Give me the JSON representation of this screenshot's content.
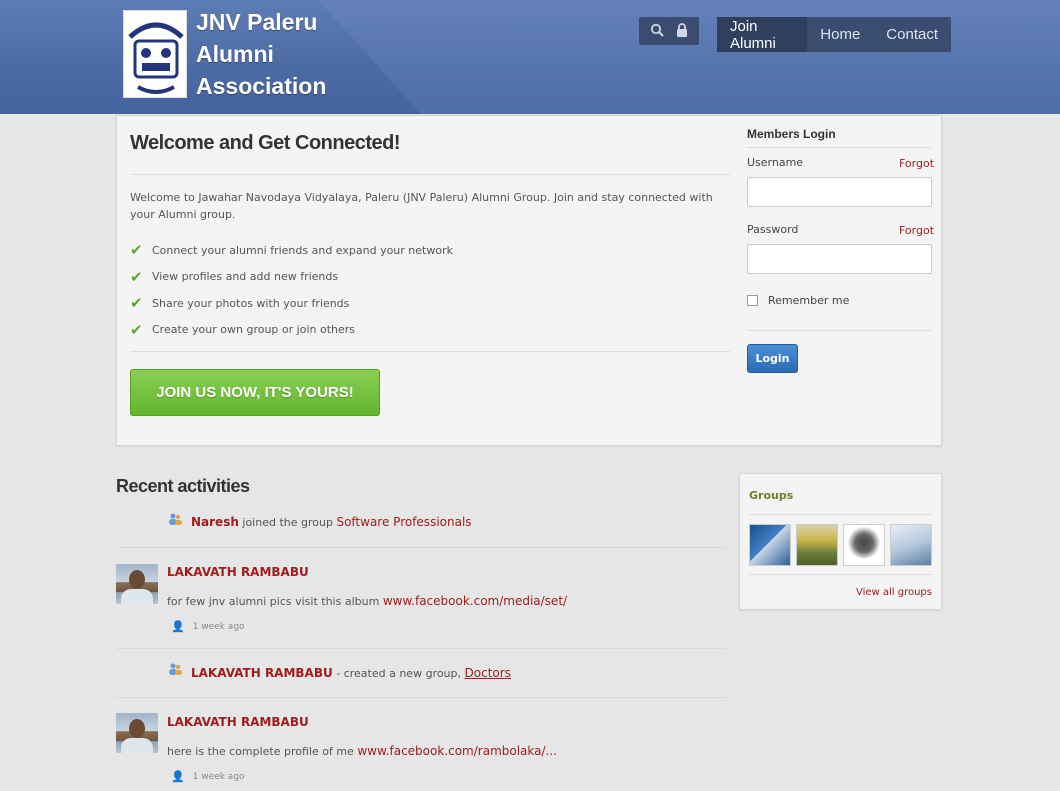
{
  "header": {
    "site_title": "JNV Paleru Alumni Association",
    "logo_icon": "school-emblem-icon",
    "tools": {
      "search_icon": "search-icon",
      "lock_icon": "lock-icon"
    },
    "nav": [
      {
        "label": "Join Alumni",
        "active": true
      },
      {
        "label": "Home",
        "active": false
      },
      {
        "label": "Contact",
        "active": false
      }
    ]
  },
  "welcome": {
    "title": "Welcome and Get Connected!",
    "intro": "Welcome to Jawahar Navodaya Vidyalaya, Paleru (JNV Paleru) Alumni Group. Join and stay connected with your Alumni group.",
    "features": [
      "Connect your alumni friends and expand your network",
      "View profiles and add new friends",
      "Share your photos with your friends",
      "Create your own group or join others"
    ],
    "join_button": "JOIN US NOW, IT'S YOURS!"
  },
  "login": {
    "title": "Members Login",
    "username_label": "Username",
    "username_value": "",
    "password_label": "Password",
    "password_value": "",
    "forgot_label": "Forgot",
    "remember_label": "Remember me",
    "remember_checked": false,
    "login_button": "Login"
  },
  "activities": {
    "title": "Recent activities",
    "items": [
      {
        "type": "group-join",
        "name": "Naresh",
        "text": "joined the group",
        "link": "Software Professionals"
      },
      {
        "type": "post",
        "name": "LAKAVATH RAMBABU",
        "text": "for few jnv alumni pics visit this album",
        "link": "www.facebook.com/media/set/",
        "time": "1 week ago"
      },
      {
        "type": "group-create",
        "name": "LAKAVATH RAMBABU",
        "text": "- created a new group,",
        "link": "Doctors"
      },
      {
        "type": "post",
        "name": "LAKAVATH RAMBABU",
        "text": "here is the complete profile of me",
        "link": "www.facebook.com/rambolaka/...",
        "time": "1 week ago"
      }
    ]
  },
  "groups": {
    "title": "Groups",
    "thumbnails": [
      "stethoscope-thumbnail",
      "school-sign-thumbnail",
      "emblem-thumbnail",
      "office-thumbnail"
    ],
    "view_all": "View all groups"
  },
  "colors": {
    "header_blue": "#4c6aa3",
    "nav_dark": "#3a4c70",
    "link_red": "#a01d1d",
    "join_green": "#63b52d",
    "login_blue": "#2b6db5"
  }
}
